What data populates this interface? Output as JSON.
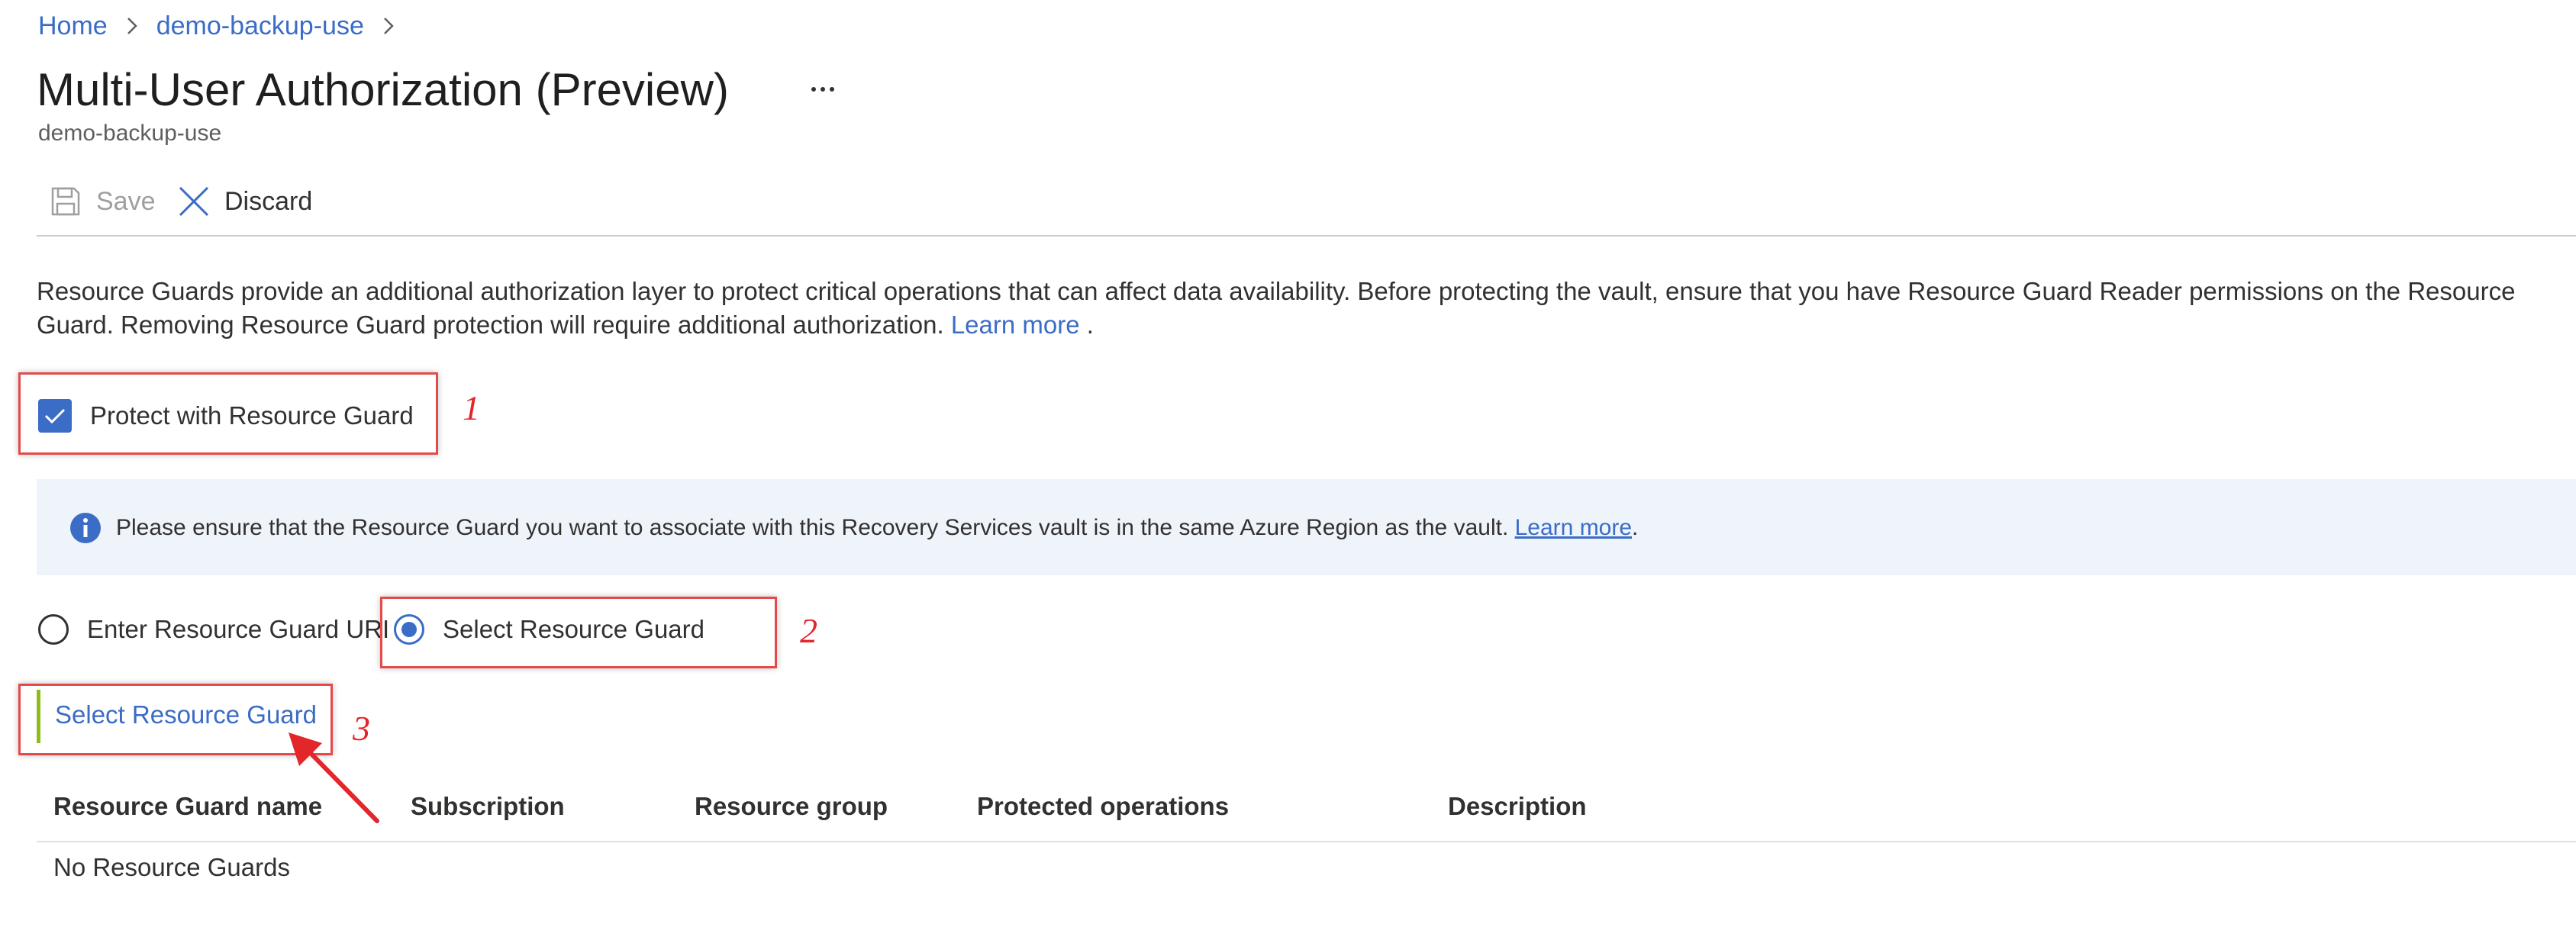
{
  "breadcrumb": {
    "items": [
      "Home",
      "demo-backup-use"
    ]
  },
  "page": {
    "title": "Multi-User Authorization (Preview)",
    "more": "...",
    "subtitle": "demo-backup-use"
  },
  "toolbar": {
    "save_label": "Save",
    "discard_label": "Discard"
  },
  "description": {
    "text": "Resource Guards provide an additional authorization layer to protect critical operations that can affect data availability. Before protecting the vault, ensure that you have Resource Guard Reader permissions on the Resource Guard. Removing Resource Guard protection will require additional authorization.",
    "learn_more": "Learn more",
    "trailing": "."
  },
  "protect_checkbox": {
    "label": "Protect with Resource Guard",
    "checked": true
  },
  "info_banner": {
    "text": "Please ensure that the Resource Guard you want to associate with this Recovery Services vault is in the same Azure Region as the vault.",
    "learn_more": "Learn more",
    "trailing": "."
  },
  "radio_options": [
    {
      "label": "Enter Resource Guard URI",
      "selected": false
    },
    {
      "label": "Select Resource Guard",
      "selected": true
    }
  ],
  "select_link": "Select Resource Guard",
  "table": {
    "headers": [
      "Resource Guard name",
      "Subscription",
      "Resource group",
      "Protected operations",
      "Description"
    ],
    "empty_text": "No Resource Guards"
  },
  "annotations": [
    "1",
    "2",
    "3"
  ],
  "colors": {
    "accent": "#3b6cc6",
    "annotation": "#e34a4a",
    "info_background": "#eff4fb",
    "link_bar": "#8cbd18"
  },
  "icons": [
    "chevron-right-icon",
    "more-icon",
    "save-icon",
    "close-icon",
    "checkmark-icon",
    "info-icon"
  ]
}
